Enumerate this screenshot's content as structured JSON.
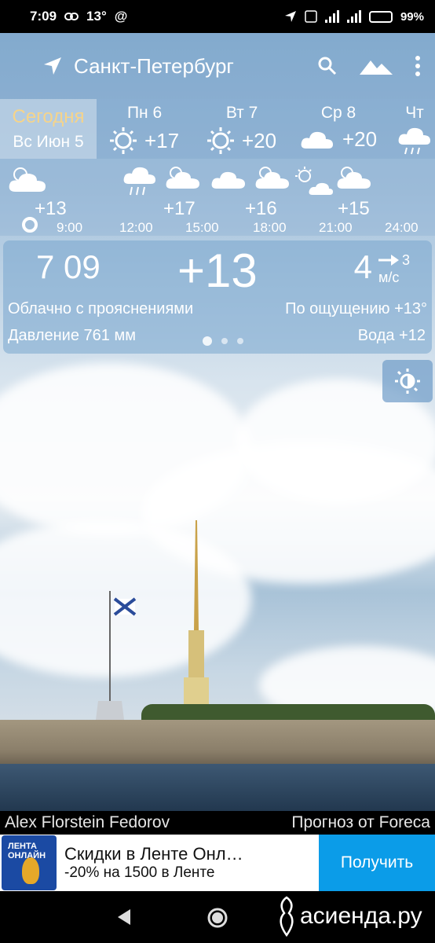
{
  "status_bar": {
    "time": "7:09",
    "notif_temp": "13°",
    "battery": "99%"
  },
  "header": {
    "city": "Санкт-Петербург"
  },
  "today": {
    "label": "Сегодня",
    "date": "Вс Июн 5"
  },
  "days": [
    {
      "name": "Пн 6",
      "temp": "+17",
      "icon": "sun-icon"
    },
    {
      "name": "Вт 7",
      "temp": "+20",
      "icon": "sun-icon"
    },
    {
      "name": "Ср 8",
      "temp": "+20",
      "icon": "cloud-icon"
    },
    {
      "name": "Чт",
      "temp": "",
      "icon": "rain-icon"
    }
  ],
  "hourly": {
    "temps": [
      "+13",
      "+17",
      "+16",
      "+15"
    ],
    "times": [
      "9:00",
      "12:00",
      "15:00",
      "18:00",
      "21:00",
      "24:00"
    ]
  },
  "current": {
    "time": "7 09",
    "temp": "+13",
    "wind_speed": "4",
    "wind_dir_value": "3",
    "wind_unit": "м/с",
    "description": "Облачно с прояснениями",
    "feels_like": "По ощущению +13°",
    "pressure": "Давление 761 мм",
    "water": "Вода +12"
  },
  "credits": {
    "photo": "Alex Florstein Fedorov",
    "forecast": "Прогноз от Foreca"
  },
  "ad": {
    "logo_text": "ЛЕНТА ОНЛАЙН",
    "title": "Скидки в Ленте Онл…",
    "subtitle": "-20% на 1500 в Ленте",
    "cta": "Получить"
  },
  "watermark": "асиенда.ру"
}
